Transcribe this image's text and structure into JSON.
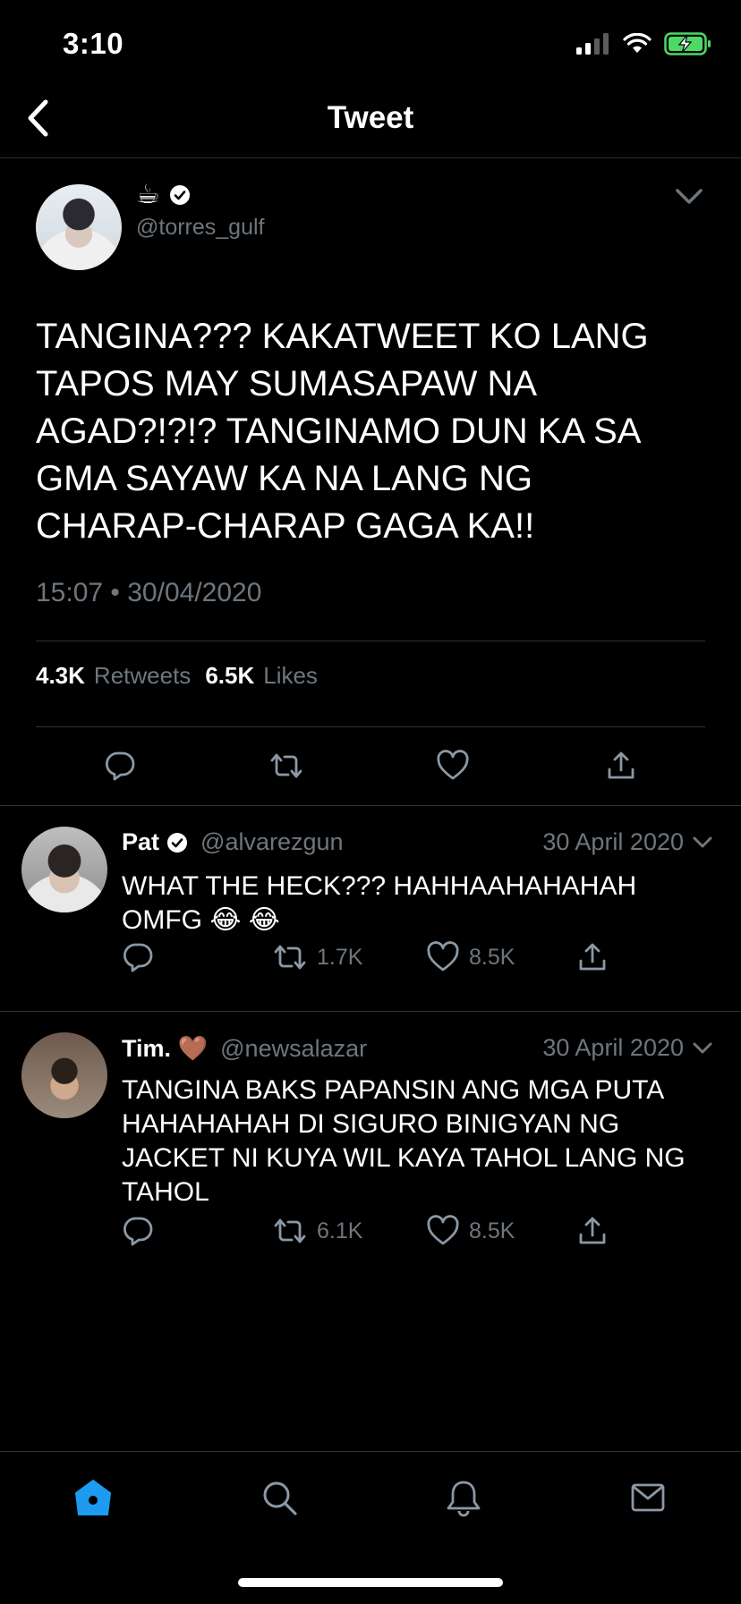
{
  "status_bar": {
    "time": "3:10"
  },
  "header": {
    "title": "Tweet"
  },
  "main_tweet": {
    "display_name": "☕",
    "verified": true,
    "handle": "@torres_gulf",
    "text": "TANGINA??? KAKATWEET KO LANG TAPOS MAY SUMASAPAW NA AGAD?!?!? TANGINAMO DUN KA SA GMA SAYAW KA NA LANG NG CHARAP-CHARAP GAGA KA!!",
    "timestamp": "15:07 • 30/04/2020",
    "retweets_count": "4.3K",
    "retweets_label": "Retweets",
    "likes_count": "6.5K",
    "likes_label": "Likes"
  },
  "replies": [
    {
      "display_name": "Pat",
      "verified": true,
      "handle": "@alvarezgun",
      "date": "30 April 2020",
      "text": "WHAT THE HECK??? HAHHAAHAHAHAH OMFG 😂 😂",
      "retweets": "1.7K",
      "likes": "8.5K"
    },
    {
      "display_name": "Tim. 🤎",
      "verified": false,
      "handle": "@newsalazar",
      "date": "30 April 2020",
      "text": "TANGINA BAKS PAPANSIN ANG MGA PUTA HAHAHAHAH DI SIGURO BINIGYAN NG JACKET NI KUYA WIL KAYA TAHOL LANG NG TAHOL",
      "retweets": "6.1K",
      "likes": "8.5K"
    }
  ],
  "tabbar": {
    "items": [
      "home-icon",
      "search-icon",
      "bell-icon",
      "mail-icon"
    ],
    "active": "home-icon"
  },
  "colors": {
    "background": "#000000",
    "secondary_text": "#6e767d",
    "divider": "#2f3336",
    "accent": "#1d9bf0",
    "battery": "#4cd964"
  }
}
